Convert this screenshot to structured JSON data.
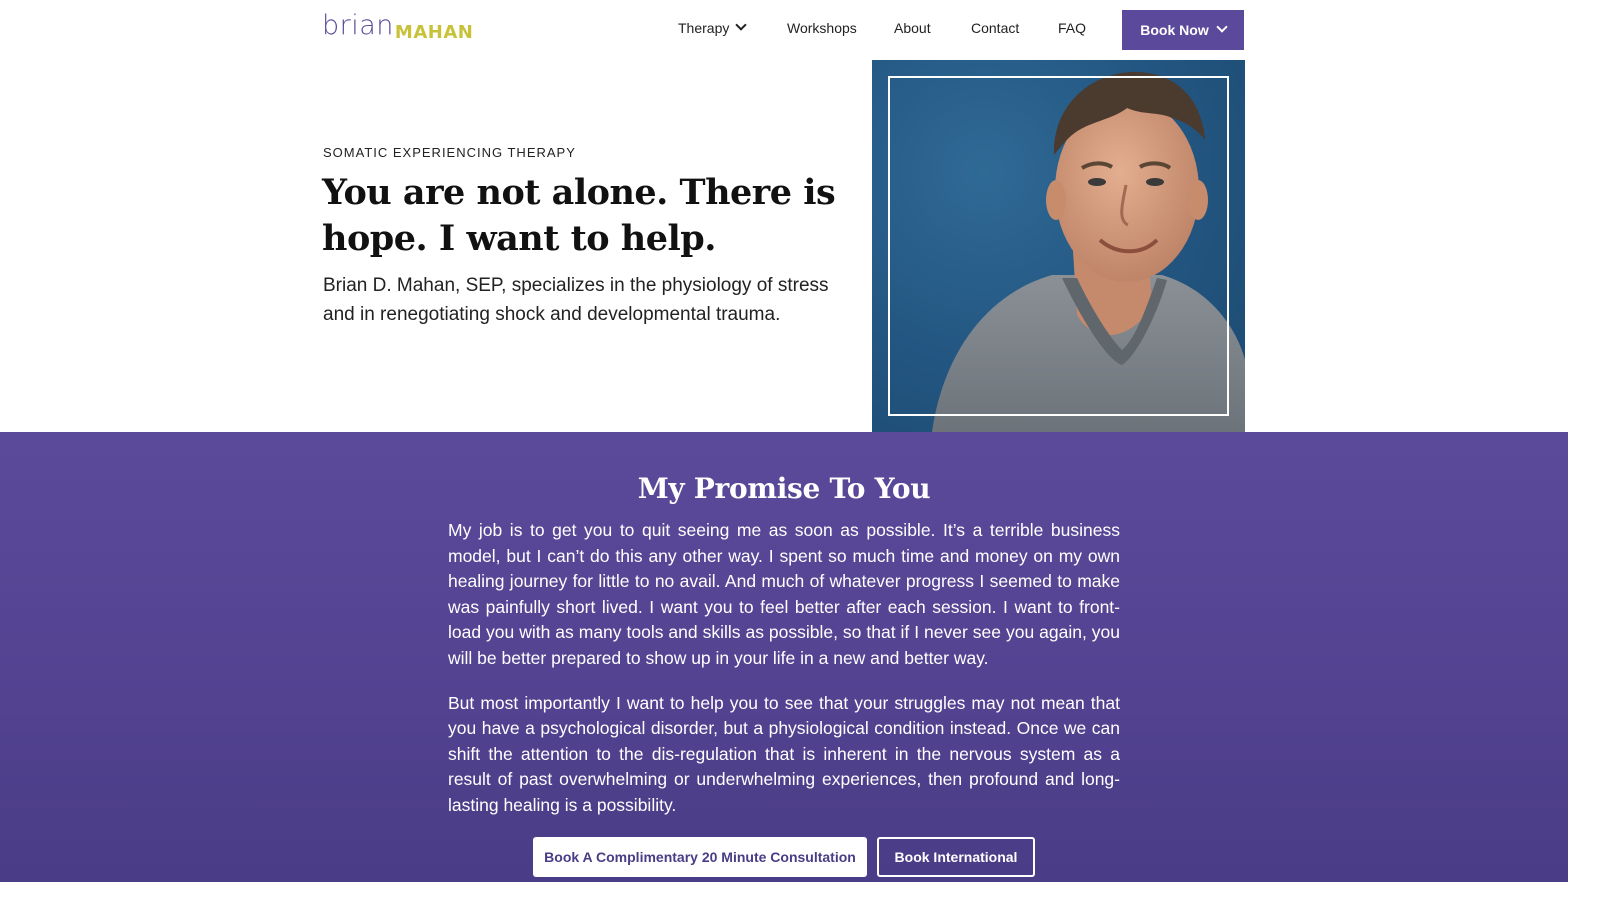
{
  "brand": {
    "first": "brian",
    "last": "MAHAN"
  },
  "nav": {
    "items": [
      {
        "label": "Therapy",
        "has_dropdown": true
      },
      {
        "label": "Workshops",
        "has_dropdown": false
      },
      {
        "label": "About",
        "has_dropdown": false
      },
      {
        "label": "Contact",
        "has_dropdown": false
      },
      {
        "label": "FAQ",
        "has_dropdown": false
      }
    ],
    "cta_label": "Book Now"
  },
  "hero": {
    "eyebrow": "SOMATIC EXPERIENCING THERAPY",
    "title": "You are not alone. There is hope. I want to help.",
    "subtitle": "Brian D. Mahan, SEP, specializes in the physiology of stress and in renegotiating shock and developmental trauma."
  },
  "promise": {
    "title": "My Promise To You",
    "paragraphs": [
      "My job is to get you to quit seeing me as soon as possible. It’s a terrible business model, but I can’t do this any other way. I spent so much time and money on my own healing journey for little to no avail. And much of whatever progress I seemed to make was painfully short lived. I want you to feel better after each session. I want to front-load you with as many tools and skills as possible, so that if I never see you again, you will be better prepared to show up in your life in a new and better way.",
      "But most importantly I want to help you to see that your struggles may not mean that you have a psychological disorder, but a physiological condition instead. Once we can shift the attention to the dis-regulation that is inherent in the nervous system as a result of past overwhelming or underwhelming experiences, then profound and long-lasting healing is a possibility."
    ],
    "primary_button": "Book A Complimentary 20 Minute Consultation",
    "secondary_button": "Book International"
  },
  "colors": {
    "brand_purple": "#5b4a9b",
    "brand_yellow": "#c8c23a",
    "photo_blue": "#225580"
  }
}
